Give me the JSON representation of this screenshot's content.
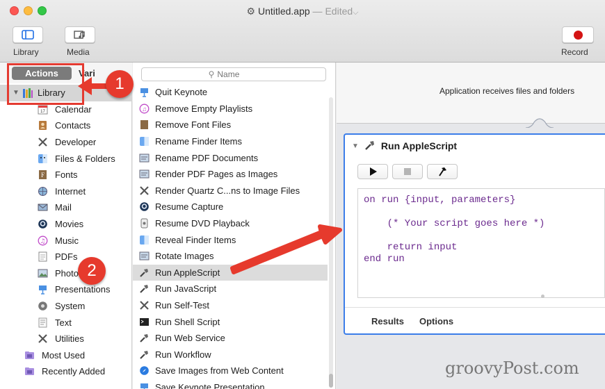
{
  "window": {
    "title": "Untitled.app",
    "separator": " — ",
    "status": "Edited",
    "status_chevron": "⌵"
  },
  "toolbar": {
    "library_label": "Library",
    "media_label": "Media",
    "record_label": "Record"
  },
  "library_panel": {
    "tab_actions": "Actions",
    "tab_variables": "Variables",
    "root": "Library",
    "items": [
      "Calendar",
      "Contacts",
      "Developer",
      "Files & Folders",
      "Fonts",
      "Internet",
      "Mail",
      "Movies",
      "Music",
      "PDFs",
      "Photos",
      "Presentations",
      "System",
      "Text",
      "Utilities"
    ],
    "most_used": "Most Used",
    "recently_added": "Recently Added"
  },
  "actions_panel": {
    "search_placeholder": "Name",
    "items": [
      "Quit Keynote",
      "Remove Empty Playlists",
      "Remove Font Files",
      "Rename Finder Items",
      "Rename PDF Documents",
      "Render PDF Pages as Images",
      "Render Quartz C...ns to Image Files",
      "Resume Capture",
      "Resume DVD Playback",
      "Reveal Finder Items",
      "Rotate Images",
      "Run AppleScript",
      "Run JavaScript",
      "Run Self-Test",
      "Run Shell Script",
      "Run Web Service",
      "Run Workflow",
      "Save Images from Web Content",
      "Save Keynote Presentation"
    ],
    "selected": "Run AppleScript"
  },
  "workflow": {
    "receives_text": "Application receives files and folders",
    "action_title": "Run AppleScript",
    "code": [
      "on run {input, parameters}",
      "",
      "    (* Your script goes here *)",
      "",
      "    return input",
      "end run"
    ],
    "tab_results": "Results",
    "tab_options": "Options"
  },
  "annotations": {
    "badge_1": "1",
    "badge_2": "2"
  },
  "watermark": "groovyPost.com",
  "colors": {
    "accent_blue": "#3b7de9",
    "annotation_red": "#e43b31",
    "code_purple": "#6b2a8e"
  }
}
